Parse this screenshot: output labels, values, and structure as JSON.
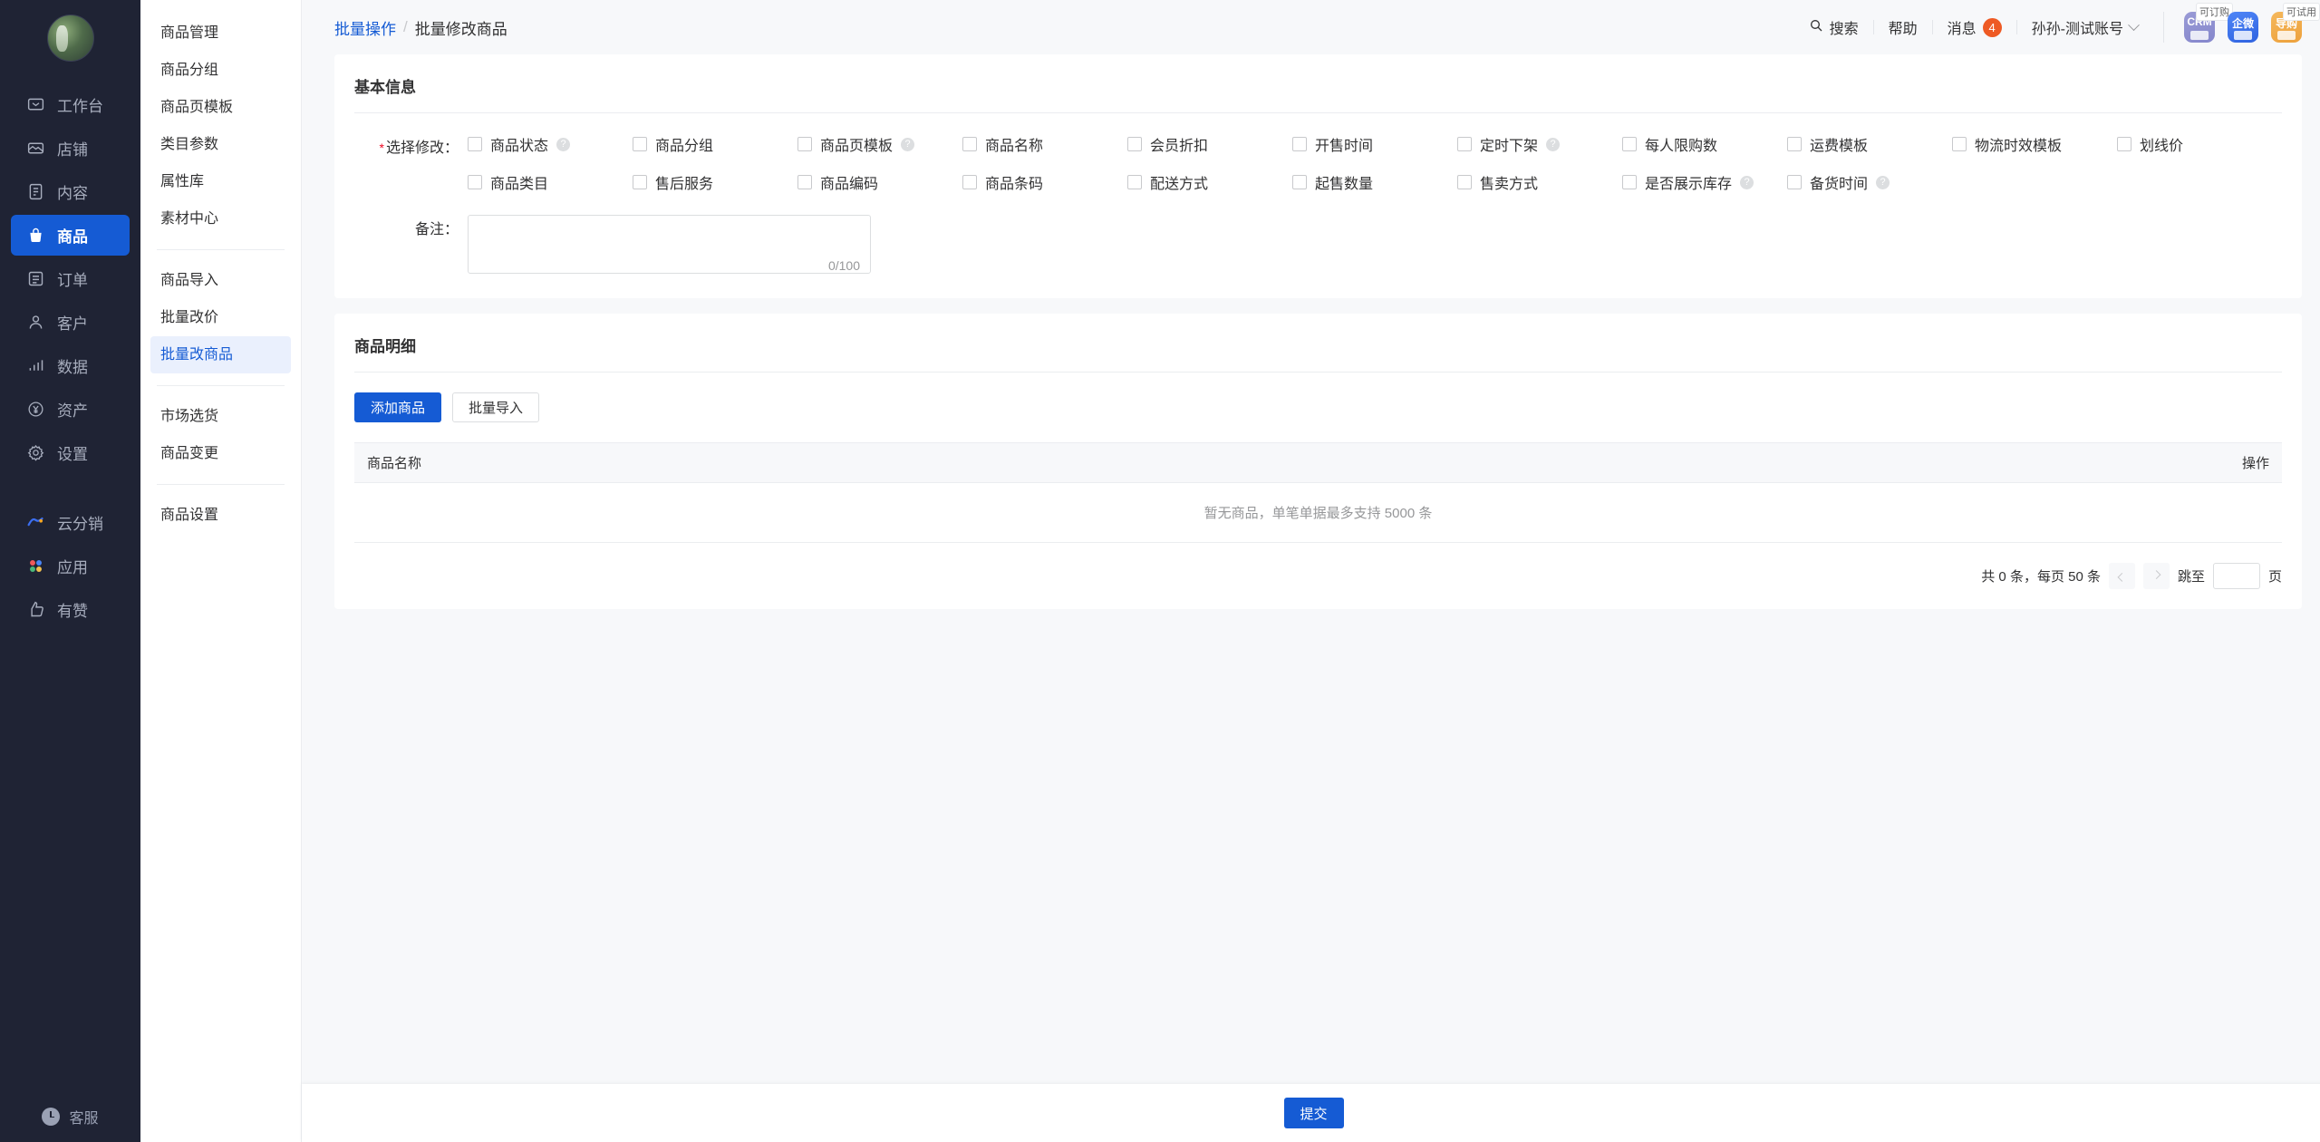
{
  "sidebar": {
    "avatar_name": "user-avatar",
    "items": [
      {
        "label": "工作台",
        "icon": "workbench-icon",
        "active": false
      },
      {
        "label": "店铺",
        "icon": "shop-icon",
        "active": false
      },
      {
        "label": "内容",
        "icon": "content-icon",
        "active": false
      },
      {
        "label": "商品",
        "icon": "goods-icon",
        "active": true
      },
      {
        "label": "订单",
        "icon": "order-icon",
        "active": false
      },
      {
        "label": "客户",
        "icon": "customer-icon",
        "active": false
      },
      {
        "label": "数据",
        "icon": "data-icon",
        "active": false
      },
      {
        "label": "资产",
        "icon": "asset-icon",
        "active": false
      },
      {
        "label": "设置",
        "icon": "settings-icon",
        "active": false
      }
    ],
    "items2": [
      {
        "label": "云分销",
        "icon": "cloud-distribution-icon"
      },
      {
        "label": "应用",
        "icon": "apps-icon"
      },
      {
        "label": "有赞",
        "icon": "youzan-icon"
      }
    ],
    "support_label": "客服",
    "support_icon": "headset-icon",
    "active_color": "#155bd4"
  },
  "submenu": {
    "group1": [
      "商品管理",
      "商品分组",
      "商品页模板",
      "类目参数",
      "属性库",
      "素材中心"
    ],
    "group2": [
      "商品导入",
      "批量改价",
      "批量改商品"
    ],
    "group3": [
      "市场选货",
      "商品变更"
    ],
    "group4": [
      "商品设置"
    ],
    "active": "批量改商品"
  },
  "topbar": {
    "breadcrumb": {
      "parent": "批量操作",
      "separator": "/",
      "current": "批量修改商品"
    },
    "search_label": "搜索",
    "search_icon": "search-icon",
    "help_label": "帮助",
    "message_label": "消息",
    "message_count": "4",
    "account_label": "孙孙-测试账号",
    "apps": [
      {
        "name": "CRM",
        "tip": "可订购"
      },
      {
        "name": "企微",
        "tip": ""
      },
      {
        "name": "导购",
        "tip": "可试用"
      }
    ]
  },
  "basic": {
    "title": "基本信息",
    "select_label": "选择修改：",
    "required_mark": "*",
    "checkbox_rows": [
      [
        {
          "label": "商品状态",
          "help": true
        },
        {
          "label": "商品分组",
          "help": false
        },
        {
          "label": "商品页模板",
          "help": true
        },
        {
          "label": "商品名称",
          "help": false
        },
        {
          "label": "会员折扣",
          "help": false
        },
        {
          "label": "开售时间",
          "help": false
        },
        {
          "label": "定时下架",
          "help": true
        },
        {
          "label": "每人限购数",
          "help": false
        },
        {
          "label": "运费模板",
          "help": false
        },
        {
          "label": "物流时效模板",
          "help": false
        },
        {
          "label": "划线价",
          "help": false
        }
      ],
      [
        {
          "label": "商品类目",
          "help": false
        },
        {
          "label": "售后服务",
          "help": false
        },
        {
          "label": "商品编码",
          "help": false
        },
        {
          "label": "商品条码",
          "help": false
        },
        {
          "label": "配送方式",
          "help": false
        },
        {
          "label": "起售数量",
          "help": false
        },
        {
          "label": "售卖方式",
          "help": false
        },
        {
          "label": "是否展示库存",
          "help": true
        },
        {
          "label": "备货时间",
          "help": true
        }
      ]
    ],
    "remark_label": "备注：",
    "remark_value": "",
    "remark_counter": "0/100"
  },
  "detail": {
    "title": "商品明细",
    "add_button": "添加商品",
    "import_button": "批量导入",
    "columns": {
      "name": "商品名称",
      "action": "操作"
    },
    "empty_text": "暂无商品，单笔单据最多支持 5000 条",
    "pagination": {
      "total_text": "共 0 条，每页 50 条",
      "jump_label": "跳至",
      "page_unit": "页",
      "jump_value": ""
    }
  },
  "footer": {
    "submit_label": "提交"
  }
}
